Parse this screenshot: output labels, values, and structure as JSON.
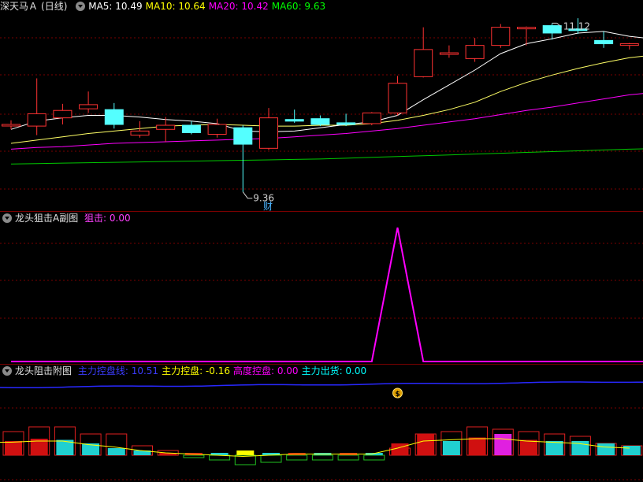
{
  "main": {
    "title": "深天马Ａ",
    "period": "(日线)",
    "ma": [
      {
        "label": "MA5: 10.49",
        "color": "#ffffff"
      },
      {
        "label": "MA10: 10.64",
        "color": "#ffff00"
      },
      {
        "label": "MA20: 10.42",
        "color": "#ff00ff"
      },
      {
        "label": "MA60: 9.63",
        "color": "#00ff00"
      }
    ],
    "high_label": "11.12",
    "low_label": "9.36",
    "fin_marker": "财",
    "candles": [
      {
        "o": 10.18,
        "c": 10.18,
        "h": 10.23,
        "l": 10.12
      },
      {
        "o": 10.16,
        "c": 10.31,
        "h": 10.74,
        "l": 10.05
      },
      {
        "o": 10.26,
        "c": 10.35,
        "h": 10.43,
        "l": 10.18
      },
      {
        "o": 10.37,
        "c": 10.42,
        "h": 10.58,
        "l": 10.32
      },
      {
        "o": 10.36,
        "c": 10.18,
        "h": 10.44,
        "l": 10.13
      },
      {
        "o": 10.05,
        "c": 10.1,
        "h": 10.22,
        "l": 10.02
      },
      {
        "o": 10.12,
        "c": 10.17,
        "h": 10.27,
        "l": 9.97
      },
      {
        "o": 10.17,
        "c": 10.08,
        "h": 10.22,
        "l": 10.06
      },
      {
        "o": 10.06,
        "c": 10.18,
        "h": 10.25,
        "l": 10.02
      },
      {
        "o": 10.14,
        "c": 9.94,
        "h": 10.17,
        "l": 9.36
      },
      {
        "o": 9.89,
        "c": 10.26,
        "h": 10.38,
        "l": 9.87
      },
      {
        "o": 10.24,
        "c": 10.22,
        "h": 10.36,
        "l": 10.2
      },
      {
        "o": 10.25,
        "c": 10.18,
        "h": 10.29,
        "l": 10.16
      },
      {
        "o": 10.2,
        "c": 10.18,
        "h": 10.31,
        "l": 10.16
      },
      {
        "o": 10.19,
        "c": 10.32,
        "h": 10.33,
        "l": 10.17
      },
      {
        "o": 10.32,
        "c": 10.68,
        "h": 10.77,
        "l": 10.29
      },
      {
        "o": 10.76,
        "c": 11.09,
        "h": 11.36,
        "l": 10.75
      },
      {
        "o": 11.05,
        "c": 11.05,
        "h": 11.14,
        "l": 10.99
      },
      {
        "o": 10.98,
        "c": 11.14,
        "h": 11.23,
        "l": 10.94
      },
      {
        "o": 11.14,
        "c": 11.36,
        "h": 11.4,
        "l": 11.11
      },
      {
        "o": 11.36,
        "c": 11.36,
        "h": 11.37,
        "l": 11.14
      },
      {
        "o": 11.38,
        "c": 11.29,
        "h": 11.41,
        "l": 11.21
      },
      {
        "o": 11.34,
        "c": 11.32,
        "h": 11.47,
        "l": 11.28
      },
      {
        "o": 11.2,
        "c": 11.16,
        "h": 11.31,
        "l": 11.11
      },
      {
        "o": 11.14,
        "c": 11.16,
        "h": 11.17,
        "l": 11.09
      }
    ],
    "ma5": [
      10.12,
      10.22,
      10.26,
      10.29,
      10.29,
      10.27,
      10.24,
      10.22,
      10.19,
      10.1,
      10.09,
      10.1,
      10.14,
      10.18,
      10.21,
      10.29,
      10.48,
      10.66,
      10.84,
      11.04,
      11.16,
      11.22,
      11.29,
      11.31,
      11.25
    ],
    "ma10": [
      9.95,
      9.99,
      10.03,
      10.07,
      10.1,
      10.13,
      10.16,
      10.17,
      10.18,
      10.17,
      10.16,
      10.16,
      10.17,
      10.17,
      10.19,
      10.23,
      10.29,
      10.36,
      10.45,
      10.58,
      10.69,
      10.78,
      10.86,
      10.93,
      10.99
    ],
    "ma20": [
      9.88,
      9.9,
      9.91,
      9.93,
      9.95,
      9.96,
      9.97,
      9.98,
      9.99,
      10.0,
      10.01,
      10.03,
      10.05,
      10.07,
      10.1,
      10.13,
      10.17,
      10.21,
      10.25,
      10.3,
      10.35,
      10.39,
      10.44,
      10.49,
      10.54
    ],
    "ma60": [
      9.7,
      9.705,
      9.71,
      9.715,
      9.72,
      9.725,
      9.73,
      9.735,
      9.74,
      9.745,
      9.75,
      9.755,
      9.76,
      9.77,
      9.78,
      9.79,
      9.8,
      9.81,
      9.82,
      9.83,
      9.84,
      9.85,
      9.86,
      9.87,
      9.88
    ],
    "colors": {
      "up": "#ff3232",
      "down": "#54ffff",
      "bg": "#000000"
    }
  },
  "sub1": {
    "title": "龙头狙击A副图",
    "value_label": "狙击: 0.00",
    "values": [
      0,
      0,
      0,
      0,
      0,
      0,
      0,
      0,
      0,
      0,
      0,
      0,
      0,
      0,
      0,
      1,
      0,
      0,
      0,
      0,
      0,
      0,
      0,
      0,
      0
    ]
  },
  "sub2": {
    "title": "龙头阻击附图",
    "labels": [
      {
        "text": "主力控盘线: 10.51",
        "color": "#3c3cff"
      },
      {
        "text": "主力控盘: -0.16",
        "color": "#ffff00"
      },
      {
        "text": "高度控盘: 0.00",
        "color": "#ff00ff"
      },
      {
        "text": "主力出货: 0.00",
        "color": "#00ffff"
      }
    ],
    "bars": [
      1.0,
      1.2,
      1.2,
      0.9,
      0.9,
      0.4,
      0.2,
      -0.1,
      -0.2,
      -0.4,
      -0.3,
      -0.2,
      -0.2,
      -0.2,
      -0.2,
      0.3,
      0.9,
      1.0,
      1.2,
      1.1,
      1.0,
      0.9,
      0.8,
      0.5,
      0.4
    ],
    "bar_fill": [
      0.6,
      0.7,
      0.65,
      0.5,
      0.3,
      0.2,
      0.1,
      0.1,
      0.1,
      0.2,
      0.1,
      0.1,
      0.1,
      0.1,
      0.1,
      0.5,
      0.9,
      0.6,
      0.75,
      0.9,
      0.65,
      0.6,
      0.6,
      0.5,
      0.4
    ]
  }
}
